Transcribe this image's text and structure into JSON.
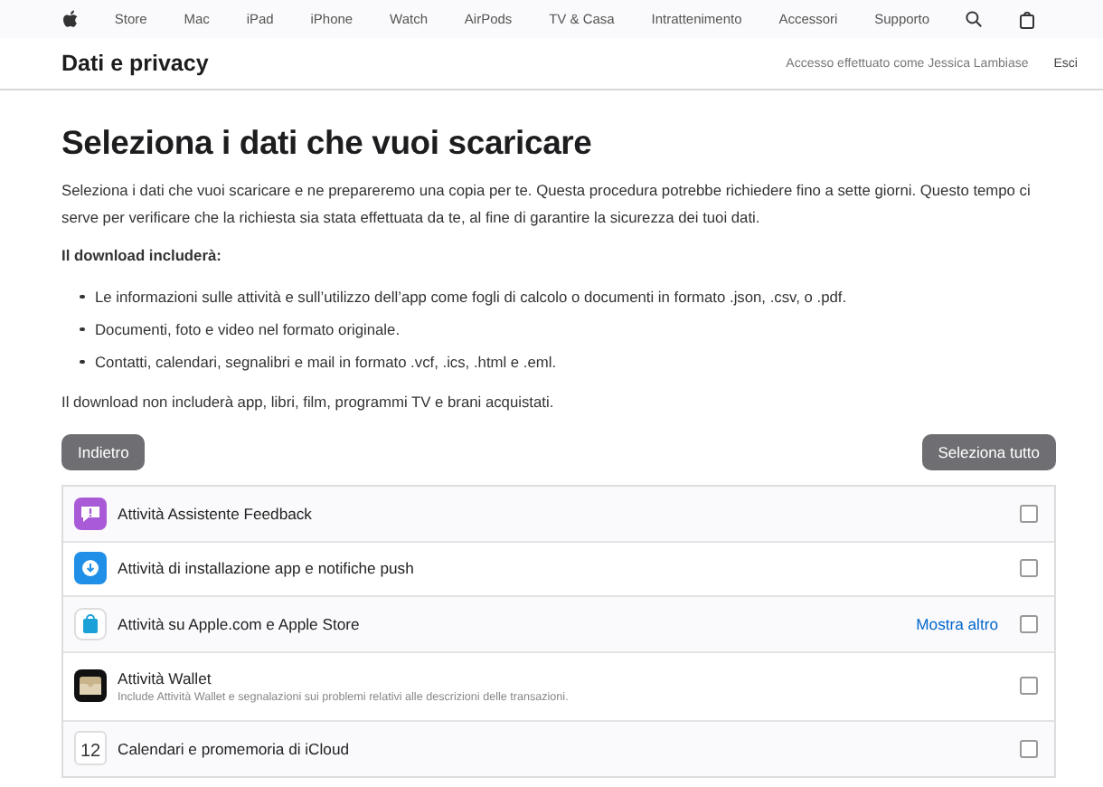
{
  "nav": {
    "items": [
      "Store",
      "Mac",
      "iPad",
      "iPhone",
      "Watch",
      "AirPods",
      "TV & Casa",
      "Intrattenimento",
      "Accessori",
      "Supporto"
    ]
  },
  "subheader": {
    "title": "Dati e privacy",
    "signed_in": "Accesso effettuato come Jessica Lambiase",
    "signout": "Esci"
  },
  "heading": "Seleziona i dati che vuoi scaricare",
  "intro": "Seleziona i dati che vuoi scaricare e ne prepareremo una copia per te. Questa procedura potrebbe richiedere fino a sette giorni. Questo tempo ci serve per verificare che la richiesta sia stata effettuata da te, al fine di garantire la sicurezza dei tuoi dati.",
  "includes_label": "Il download includerà:",
  "includes": [
    "Le informazioni sulle attività e sull’utilizzo dell’app come fogli di calcolo o documenti in formato .json, .csv, o .pdf.",
    "Documenti, foto e video nel formato originale.",
    "Contatti, calendari, segnalibri e mail in formato .vcf, .ics, .html e .eml."
  ],
  "excludes": "Il download non includerà app, libri, film, programmi TV e brani acquistati.",
  "buttons": {
    "back": "Indietro",
    "select_all": "Seleziona tutto"
  },
  "rows": [
    {
      "kind": "feedback",
      "label": "Attività Assistente Feedback",
      "checked": false
    },
    {
      "kind": "install",
      "label": "Attività di installazione app e notifiche push",
      "checked": false
    },
    {
      "kind": "store",
      "label": "Attività su Apple.com e Apple Store",
      "link": "Mostra altro",
      "checked": false
    },
    {
      "kind": "wallet",
      "label": "Attività Wallet",
      "description": "Include Attività Wallet e segnalazioni sui problemi relativi alle descrizioni delle transazioni.",
      "checked": false
    },
    {
      "kind": "calendar",
      "label": "Calendari e promemoria di iCloud",
      "icon_text": "12",
      "checked": false
    }
  ]
}
